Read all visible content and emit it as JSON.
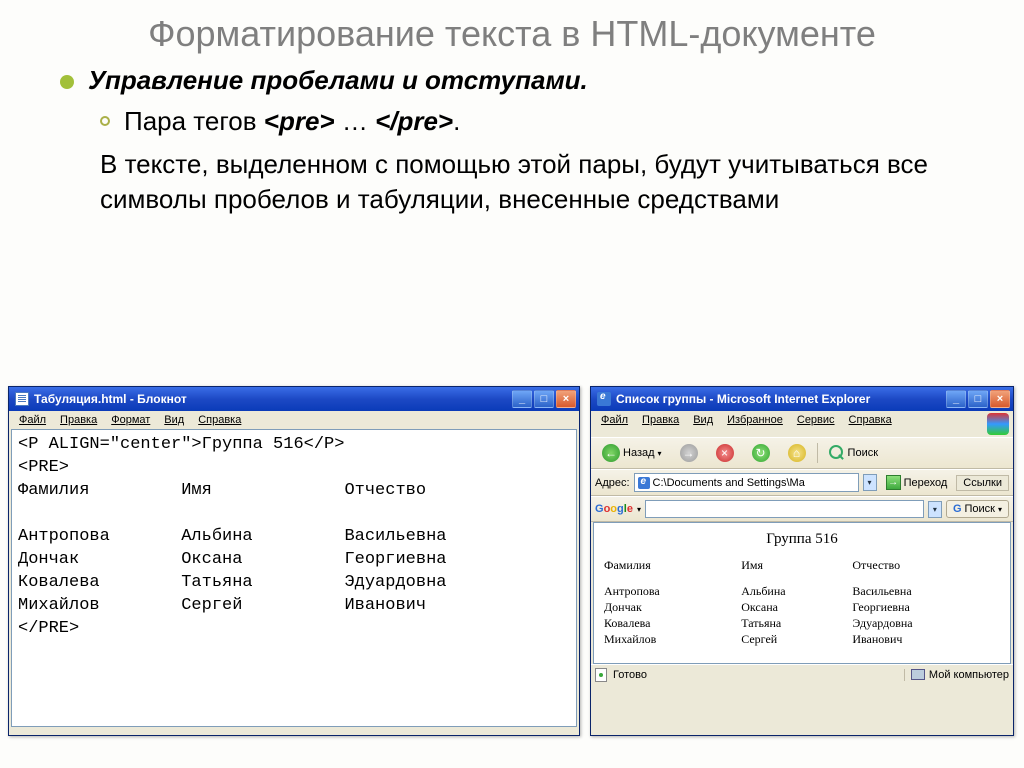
{
  "slide": {
    "title": "Форматирование текста в HTML-документе",
    "bullet": "Управление пробелами и отступами.",
    "tagline_prefix": "Пара тегов ",
    "tag_open": "<pre>",
    "tagline_mid": " … ",
    "tag_close": "</pre>",
    "tagline_end": ".",
    "paragraph": "В тексте, выделенном с помощью этой пары, будут    учитываться все символы пробелов и табуляции,    внесенные средствами"
  },
  "notepad": {
    "title": "Табуляция.html - Блокнот",
    "menu": {
      "file": "Файл",
      "edit": "Правка",
      "format": "Формат",
      "view": "Вид",
      "help": "Справка"
    },
    "code": "<P ALIGN=\"center\">Группа 516</P>\n<PRE>\nФамилия         Имя             Отчество\n\nАнтропова       Альбина         Васильевна\nДончак          Оксана          Георгиевна\nКовалева        Татьяна         Эдуардовна\nМихайлов        Сергей          Иванович\n</PRE>"
  },
  "ie": {
    "title": "Список группы - Microsoft Internet Explorer",
    "menu": {
      "file": "Файл",
      "edit": "Правка",
      "view": "Вид",
      "fav": "Избранное",
      "tools": "Сервис",
      "help": "Справка"
    },
    "toolbar": {
      "back": "Назад",
      "search": "Поиск"
    },
    "address_label": "Адрес:",
    "address_value": "C:\\Documents and Settings\\Ма",
    "go": "Переход",
    "links": "Ссылки",
    "google": "Google",
    "gsearch": "Поиск",
    "content_title": "Группа 516",
    "headers": [
      "Фамилия",
      "Имя",
      "Отчество"
    ],
    "rows": [
      [
        "Антропова",
        "Альбина",
        "Васильевна"
      ],
      [
        "Дончак",
        "Оксана",
        "Георгиевна"
      ],
      [
        "Ковалева",
        "Татьяна",
        "Эдуардовна"
      ],
      [
        "Михайлов",
        "Сергей",
        "Иванович"
      ]
    ],
    "status_ready": "Готово",
    "status_comp": "Мой компьютер"
  }
}
